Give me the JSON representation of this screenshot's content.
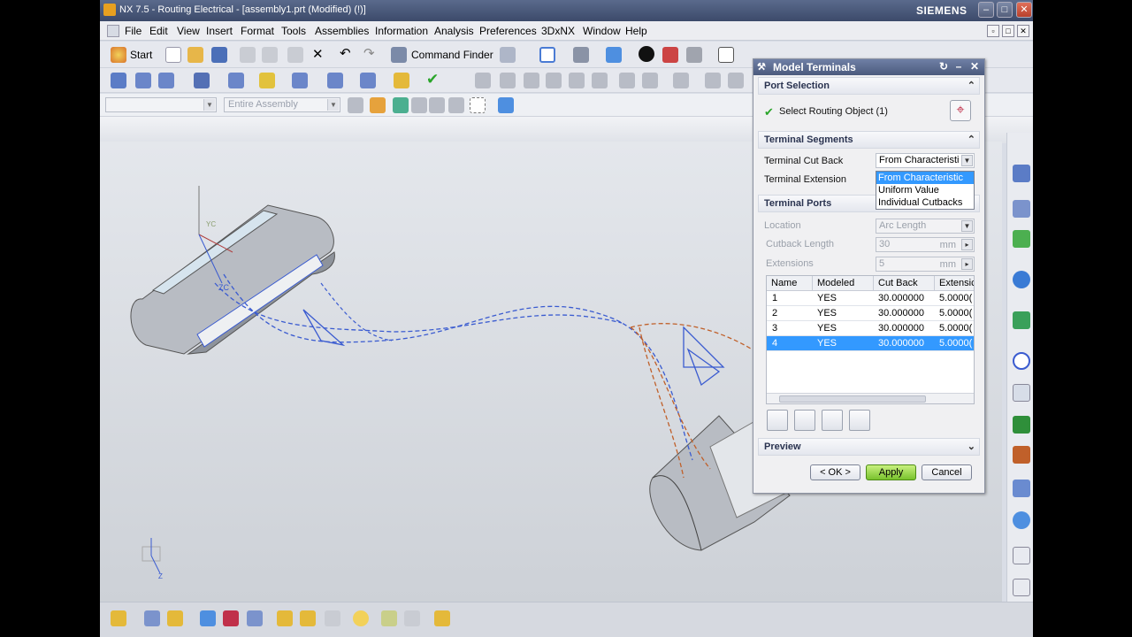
{
  "window": {
    "title": "NX 7.5 - Routing Electrical - [assembly1.prt (Modified)    (!)]",
    "brand": "SIEMENS"
  },
  "menu": [
    "File",
    "Edit",
    "View",
    "Insert",
    "Format",
    "Tools",
    "Assemblies",
    "Information",
    "Analysis",
    "Preferences",
    "3DxNX",
    "Window",
    "Help"
  ],
  "toolbar": {
    "start_label": "Start",
    "command_finder_label": "Command Finder",
    "assembly_filter_placeholder": "Entire Assembly"
  },
  "dialog": {
    "title": "Model Terminals",
    "port_selection": {
      "header": "Port Selection",
      "select_label": "Select Routing Object (1)"
    },
    "terminal_segments": {
      "header": "Terminal Segments",
      "cut_back_label": "Terminal Cut Back",
      "cut_back_value": "From Characteristi",
      "extension_label": "Terminal Extension",
      "dropdown_options": [
        "From Characteristic",
        "Uniform Value",
        "Individual Cutbacks"
      ],
      "dropdown_selected_index": 0
    },
    "terminal_ports": {
      "header": "Terminal Ports",
      "location_label": "Location",
      "location_value": "Arc Length",
      "cutback_length_label": "Cutback Length",
      "cutback_length_value": "30",
      "extensions_label": "Extensions",
      "extensions_value": "5",
      "unit": "mm",
      "columns": [
        "Name",
        "Modeled",
        "Cut Back",
        "Extensic"
      ],
      "rows": [
        {
          "name": "1",
          "modeled": "YES",
          "cut_back": "30.000000",
          "extension": "5.0000("
        },
        {
          "name": "2",
          "modeled": "YES",
          "cut_back": "30.000000",
          "extension": "5.0000("
        },
        {
          "name": "3",
          "modeled": "YES",
          "cut_back": "30.000000",
          "extension": "5.0000("
        },
        {
          "name": "4",
          "modeled": "YES",
          "cut_back": "30.000000",
          "extension": "5.0000("
        }
      ],
      "selected_row_index": 3
    },
    "preview_header": "Preview",
    "buttons": {
      "ok": "< OK >",
      "apply": "Apply",
      "cancel": "Cancel"
    }
  },
  "colors": {
    "accent": "#3399ff",
    "apply_green": "#79c22d",
    "wire_blue": "#3a5bd0",
    "wire_orange": "#c0602a"
  }
}
